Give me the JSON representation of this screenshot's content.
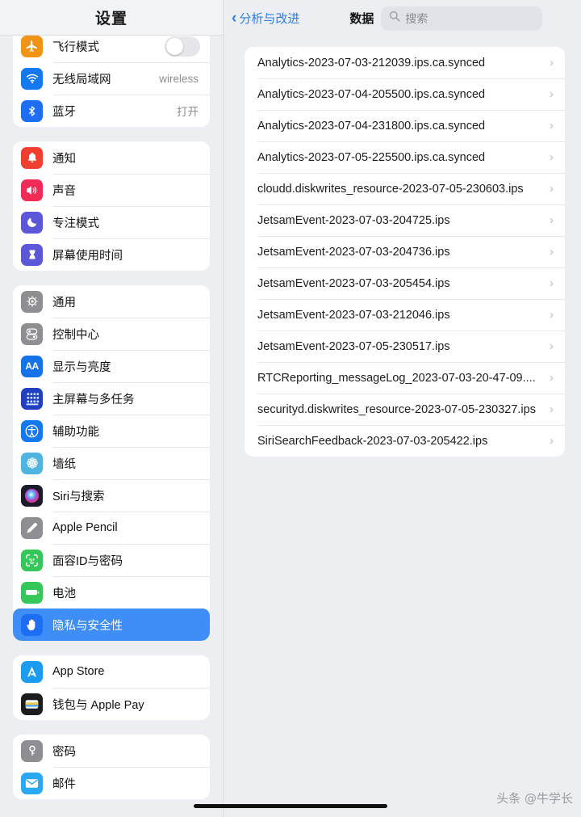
{
  "sidebar": {
    "title": "设置",
    "groups": [
      {
        "id": "connectivity",
        "rows": [
          {
            "label": "飞行模式",
            "icon": "airplane-icon",
            "icon_bg": "#f09418",
            "control": "toggle",
            "toggle_on": false
          },
          {
            "label": "无线局域网",
            "icon": "wifi-icon",
            "icon_bg": "#1478f0",
            "value": "wireless"
          },
          {
            "label": "蓝牙",
            "icon": "bluetooth-icon",
            "icon_bg": "#1d6ef5",
            "value": "打开"
          }
        ]
      },
      {
        "id": "alerts",
        "rows": [
          {
            "label": "通知",
            "icon": "bell-icon",
            "icon_bg": "#f03e2f"
          },
          {
            "label": "声音",
            "icon": "speaker-icon",
            "icon_bg": "#ef2b56"
          },
          {
            "label": "专注模式",
            "icon": "moon-icon",
            "icon_bg": "#5b57d8"
          },
          {
            "label": "屏幕使用时间",
            "icon": "hourglass-icon",
            "icon_bg": "#5b57d8"
          }
        ]
      },
      {
        "id": "system",
        "rows": [
          {
            "label": "通用",
            "icon": "gear-icon",
            "icon_bg": "#8e8e93"
          },
          {
            "label": "控制中心",
            "icon": "control-center-icon",
            "icon_bg": "#8e8e93"
          },
          {
            "label": "显示与亮度",
            "icon": "aa-text-icon",
            "icon_bg": "#1572e8"
          },
          {
            "label": "主屏幕与多任务",
            "icon": "home-screen-icon",
            "icon_bg": "#2040c0"
          },
          {
            "label": "辅助功能",
            "icon": "accessibility-icon",
            "icon_bg": "#1478f0"
          },
          {
            "label": "墙纸",
            "icon": "wallpaper-icon",
            "icon_bg": "#4fb5e0"
          },
          {
            "label": "Siri与搜索",
            "icon": "siri-icon",
            "icon_bg": "#1b1b2b"
          },
          {
            "label": "Apple Pencil",
            "icon": "pencil-icon",
            "icon_bg": "#8e8e93"
          },
          {
            "label": "面容ID与密码",
            "icon": "face-id-icon",
            "icon_bg": "#35c759"
          },
          {
            "label": "电池",
            "icon": "battery-icon",
            "icon_bg": "#35c759"
          },
          {
            "label": "隐私与安全性",
            "icon": "hand-raised-icon",
            "icon_bg": "#1d6ef5",
            "selected": true
          }
        ]
      },
      {
        "id": "store",
        "rows": [
          {
            "label": "App Store",
            "icon": "app-store-icon",
            "icon_bg": "#1d9bf0"
          },
          {
            "label": "钱包与 Apple Pay",
            "icon": "wallet-icon",
            "icon_bg": "#1c1c1e"
          }
        ]
      },
      {
        "id": "accounts",
        "rows": [
          {
            "label": "密码",
            "icon": "key-icon",
            "icon_bg": "#8e8e93"
          },
          {
            "label": "邮件",
            "icon": "mail-icon",
            "icon_bg": "#2aa9f0"
          }
        ]
      }
    ]
  },
  "detail": {
    "back_label": "分析与改进",
    "back_chevron": "‹",
    "title": "数据",
    "search": {
      "placeholder": "搜索",
      "value": ""
    },
    "files": [
      {
        "name": "Analytics-2023-07-03-212039.ips.ca.synced"
      },
      {
        "name": "Analytics-2023-07-04-205500.ips.ca.synced"
      },
      {
        "name": "Analytics-2023-07-04-231800.ips.ca.synced"
      },
      {
        "name": "Analytics-2023-07-05-225500.ips.ca.synced"
      },
      {
        "name": "cloudd.diskwrites_resource-2023-07-05-230603.ips"
      },
      {
        "name": "JetsamEvent-2023-07-03-204725.ips"
      },
      {
        "name": "JetsamEvent-2023-07-03-204736.ips"
      },
      {
        "name": "JetsamEvent-2023-07-03-205454.ips"
      },
      {
        "name": "JetsamEvent-2023-07-03-212046.ips"
      },
      {
        "name": "JetsamEvent-2023-07-05-230517.ips"
      },
      {
        "name": "RTCReporting_messageLog_2023-07-03-20-47-09...."
      },
      {
        "name": "securityd.diskwrites_resource-2023-07-05-230327.ips"
      },
      {
        "name": "SiriSearchFeedback-2023-07-03-205422.ips"
      }
    ],
    "row_chevron": "›"
  },
  "watermark": "头条 @牛学长",
  "colors": {
    "selection_blue": "#3f8ef7",
    "link_blue": "#2f7fe4",
    "background": "#eceef1",
    "card": "#ffffff"
  }
}
